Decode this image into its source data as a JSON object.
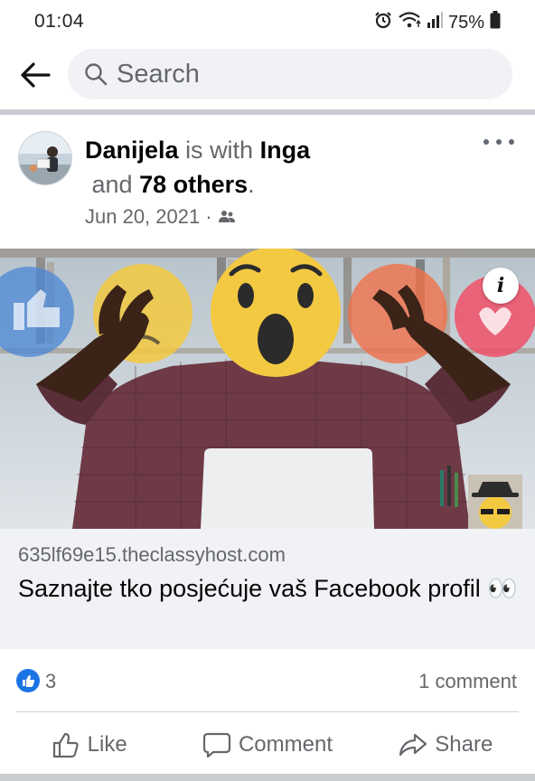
{
  "status_bar": {
    "time": "01:04",
    "battery": "75%",
    "icons": [
      "alarm-icon",
      "wifi-icon",
      "signal-icon",
      "battery-icon"
    ]
  },
  "search": {
    "placeholder": "Search"
  },
  "post": {
    "author": "Danijela",
    "with_text": "is with",
    "tagged": "Inga",
    "and_text": "and",
    "others": "78 others",
    "period": ".",
    "date": "Jun 20, 2021",
    "date_separator": "·",
    "privacy_icon": "friends-icon"
  },
  "link": {
    "domain": "635lf69e15.theclassyhost.com",
    "title": "Saznajte tko posjećuje vaš Facebook profil 👀"
  },
  "engagement": {
    "reaction_count": "3",
    "comment_count": "1 comment"
  },
  "actions": {
    "like": "Like",
    "comment": "Comment",
    "share": "Share"
  },
  "colors": {
    "accent": "#1b74e4",
    "muted_text": "#65676b",
    "surface": "#f0f2f5"
  }
}
